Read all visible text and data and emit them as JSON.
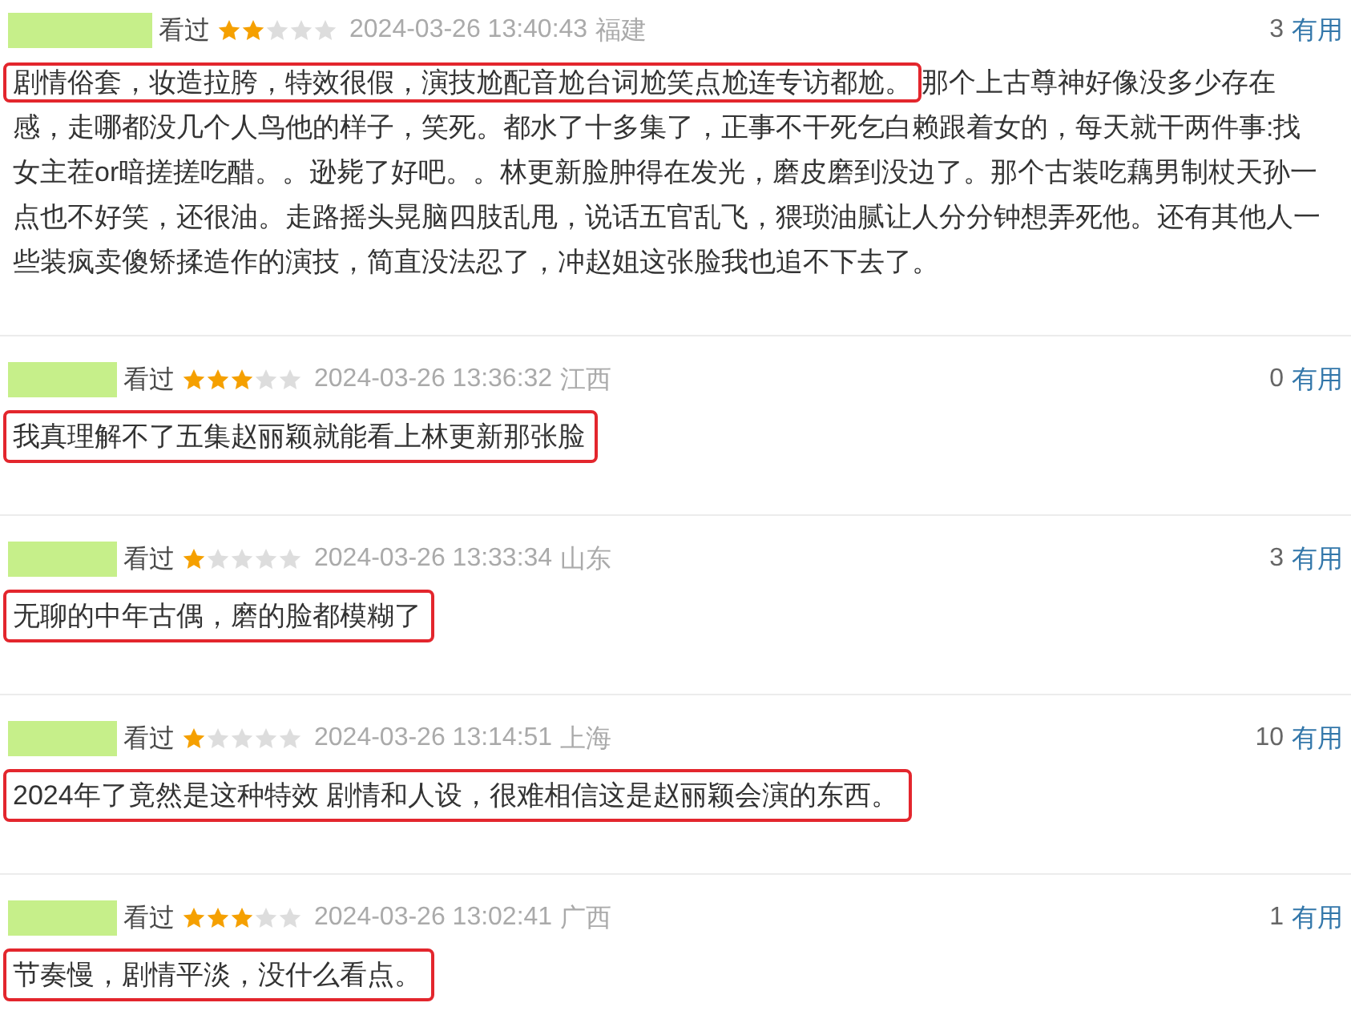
{
  "reviews": [
    {
      "name_redacted": true,
      "status": "看过",
      "stars": 2,
      "date": "2024-03-26 13:40:43",
      "location": "福建",
      "useful_count": "3",
      "useful_label": "有用",
      "comment": [
        {
          "text": "剧情俗套，妆造拉胯，特效很假，演技尬配音尬台词尬笑点尬连专访都尬。",
          "highlighted": true
        },
        {
          "text": "那个上古尊神好像没多少存在感，走哪都没几个人鸟他的样子，笑死。都水了十多集了，正事不干死乞白赖跟着女的，每天就干两件事:找女主茬or暗搓搓吃醋。。逊毙了好吧。。林更新脸肿得在发光，磨皮磨到没边了。那个古装吃藕男制杖天孙一点也不好笑，还很油。走路摇头晃脑四肢乱甩，说话五官乱飞，猥琐油腻让人分分钟想弄死他。还有其他人一些装疯卖傻矫揉造作的演技，简直没法忍了，冲赵姐这张脸我也追不下去了。",
          "highlighted": false
        }
      ]
    },
    {
      "name_redacted": true,
      "status": "看过",
      "stars": 3,
      "date": "2024-03-26 13:36:32",
      "location": "江西",
      "useful_count": "0",
      "useful_label": "有用",
      "comment": [
        {
          "text": "我真理解不了五集赵丽颖就能看上林更新那张脸",
          "highlighted": true
        }
      ]
    },
    {
      "name_redacted": true,
      "status": "看过",
      "stars": 1,
      "date": "2024-03-26 13:33:34",
      "location": "山东",
      "useful_count": "3",
      "useful_label": "有用",
      "comment": [
        {
          "text": "无聊的中年古偶，磨的脸都模糊了",
          "highlighted": true
        }
      ]
    },
    {
      "name_redacted": true,
      "status": "看过",
      "stars": 1,
      "date": "2024-03-26 13:14:51",
      "location": "上海",
      "useful_count": "10",
      "useful_label": "有用",
      "comment": [
        {
          "text": "2024年了竟然是这种特效 剧情和人设，很难相信这是赵丽颖会演的东西。",
          "highlighted": true
        }
      ]
    },
    {
      "name_redacted": true,
      "status": "看过",
      "stars": 3,
      "date": "2024-03-26 13:02:41",
      "location": "广西",
      "useful_count": "1",
      "useful_label": "有用",
      "comment": [
        {
          "text": "节奏慢，剧情平淡，没什么看点。",
          "highlighted": true
        }
      ]
    }
  ]
}
